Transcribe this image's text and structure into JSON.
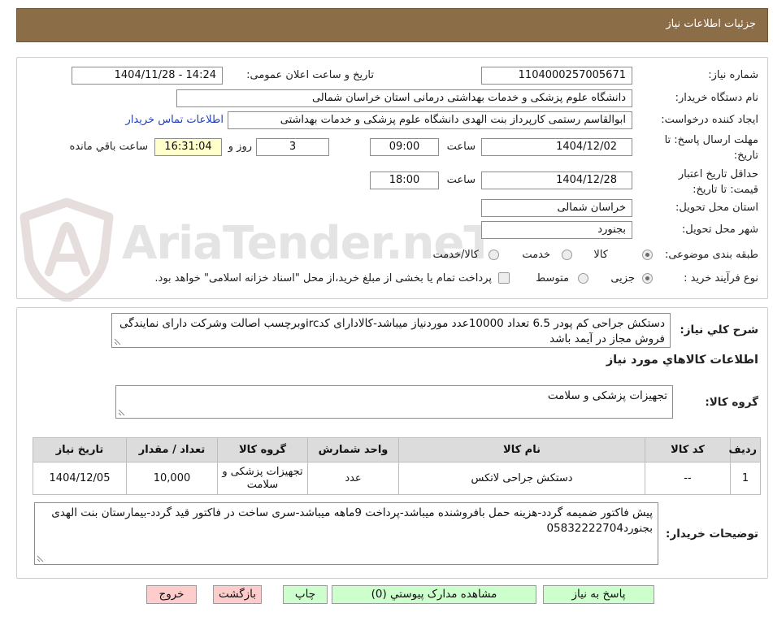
{
  "header": {
    "title": "جزئیات اطلاعات نیاز"
  },
  "watermark": {
    "text": "AriaTender.neT"
  },
  "colors": {
    "header_bg": "#8B6D47",
    "remaining_time_bg": "#FFFFCC",
    "action_button_bg": "#CCFFCC",
    "back_exit_button_bg": "#FFCCCC",
    "link": "#1F3FBF",
    "table_header_bg": "#DCDCDC"
  },
  "details": {
    "need_number": {
      "label": "شماره نیاز:",
      "value": "1104000257005671"
    },
    "announce_datetime": {
      "label": "تاریخ و ساعت اعلان عمومی:",
      "value": "1404/11/28 - 14:24"
    },
    "buyer_org": {
      "label": "نام دستگاه خریدار:",
      "value": "دانشگاه علوم پزشکی و خدمات بهداشتی درمانی استان خراسان شمالی"
    },
    "requester": {
      "label": "ایجاد کننده درخواست:",
      "value": "ابوالقاسم رستمی کارپرداز بنت الهدی دانشگاه علوم پزشکی و خدمات بهداشتی",
      "contact_link": "اطلاعات تماس خریدار"
    },
    "reply_deadline": {
      "label_lines": [
        "مهلت ارسال پاسخ: تا",
        "تاریخ:"
      ],
      "date": "1404/12/02",
      "time_label": "ساعت",
      "time": "09:00",
      "days": "3",
      "days_label": "روز و",
      "remaining": "16:31:04",
      "remaining_label": "ساعت باقي مانده"
    },
    "price_validity": {
      "label_lines": [
        "حداقل تاریخ اعتبار",
        "قیمت: تا تاریخ:"
      ],
      "date": "1404/12/28",
      "time_label": "ساعت",
      "time": "18:00"
    },
    "delivery_province": {
      "label": "استان محل تحویل:",
      "value": "خراسان شمالی"
    },
    "delivery_city": {
      "label": "شهر محل تحویل:",
      "value": "بجنورد"
    },
    "category": {
      "label": "طبقه بندی موضوعی:",
      "options": [
        {
          "label": "کالا",
          "selected": true
        },
        {
          "label": "خدمت",
          "selected": false
        },
        {
          "label": "کالا/خدمت",
          "selected": false
        }
      ]
    },
    "process_type": {
      "label": "نوع فرآیند خرید :",
      "options": [
        {
          "label": "جزیی",
          "selected": true
        },
        {
          "label": "متوسط",
          "selected": false
        }
      ],
      "treasury": {
        "label": "پرداخت تمام یا بخشی از مبلغ خرید،از محل \"اسناد خزانه اسلامی\" خواهد بود.",
        "checked": false
      }
    }
  },
  "need": {
    "description_label": "شرح کلي نياز:",
    "description": "دستکش جراحی کم پودر 6.5 تعداد 10000عدد موردنیاز میباشد-کالادارای کدircوبرچسب اصالت وشرکت دارای نمایندگی فروش مجاز در آیمد باشد",
    "items_heading": "اطلاعات کالاهاي مورد نياز",
    "group_label": "گروه کالا:",
    "group_value": "تجهیزات پزشکی و سلامت",
    "table": {
      "columns": [
        "ردیف",
        "کد کالا",
        "نام کالا",
        "واحد شمارش",
        "گروه کالا",
        "تعداد / مقدار",
        "تاریخ نیاز"
      ],
      "rows": [
        [
          "1",
          "--",
          "دستکش جراحی لاتکس",
          "عدد",
          "تجهیزات پزشکی و سلامت",
          "10,000",
          "1404/12/05"
        ]
      ]
    },
    "buyer_notes_label": "توضیحات خریدار:",
    "buyer_notes": "پیش فاکتور ضمیمه گردد-هزینه حمل بافروشنده میباشد-پرداخت 9ماهه میباشد-سری ساخت در فاکتور قید گردد-بیمارستان بنت الهدی بجنورد05832222704"
  },
  "actions": {
    "reply": "پاسخ به نیاز",
    "attachments": "مشاهده مدارک پيوستي (0)",
    "print": "چاپ",
    "back": "بازگشت",
    "exit": "خروج"
  }
}
